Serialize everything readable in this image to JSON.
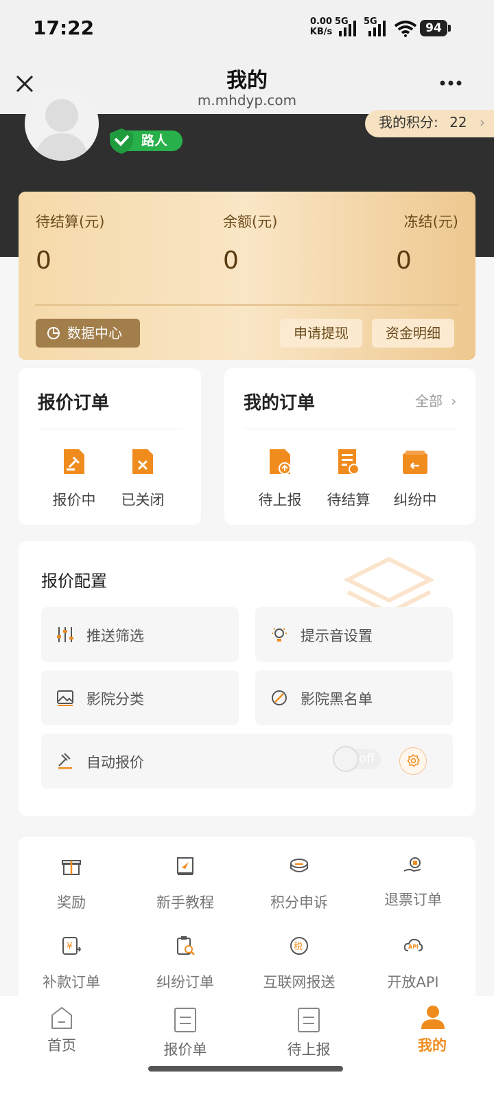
{
  "status_bar": {
    "time": "17:22",
    "net_speed": "0.00",
    "net_unit": "KB/s",
    "sig1": "5G",
    "sig2": "5G",
    "battery": "94"
  },
  "nav": {
    "title": "我的",
    "url": "m.mhdyp.com"
  },
  "profile": {
    "level": "路人",
    "points_label": "我的积分:",
    "points_value": "22"
  },
  "balance": {
    "pending_label": "待结算(元)",
    "pending_value": "0",
    "balance_label": "余额(元)",
    "balance_value": "0",
    "frozen_label": "冻结(元)",
    "frozen_value": "0",
    "data_center": "数据中心",
    "withdraw": "申请提现",
    "details": "资金明细"
  },
  "quote_orders": {
    "title": "报价订单",
    "items": [
      {
        "label": "报价中"
      },
      {
        "label": "已关闭"
      }
    ]
  },
  "my_orders": {
    "title": "我的订单",
    "all": "全部",
    "items": [
      {
        "label": "待上报"
      },
      {
        "label": "待结算"
      },
      {
        "label": "纠纷中"
      }
    ]
  },
  "config": {
    "title": "报价配置",
    "push_filter": "推送筛选",
    "sound": "提示音设置",
    "cinema_category": "影院分类",
    "cinema_blacklist": "影院黑名单",
    "auto_quote": "自动报价",
    "toggle_text": "off",
    "toggle_on": false
  },
  "grid": [
    {
      "label": "奖励",
      "icon": "gift-icon"
    },
    {
      "label": "新手教程",
      "icon": "book-icon"
    },
    {
      "label": "积分申诉",
      "icon": "coins-icon"
    },
    {
      "label": "退票订单",
      "icon": "refund-hand-icon"
    },
    {
      "label": "补款订单",
      "icon": "yuan-doc-icon"
    },
    {
      "label": "纠纷订单",
      "icon": "clipboard-search-icon"
    },
    {
      "label": "互联网报送",
      "icon": "tax-icon"
    },
    {
      "label": "开放API",
      "icon": "api-cloud-icon"
    }
  ],
  "tabs": [
    {
      "label": "首页"
    },
    {
      "label": "报价单"
    },
    {
      "label": "待上报"
    },
    {
      "label": "我的"
    }
  ],
  "colors": {
    "accent": "#f08c1e",
    "dark": "#2f2f2f",
    "gold_btn": "#a27e4b",
    "green_badge": "#28b04a"
  }
}
